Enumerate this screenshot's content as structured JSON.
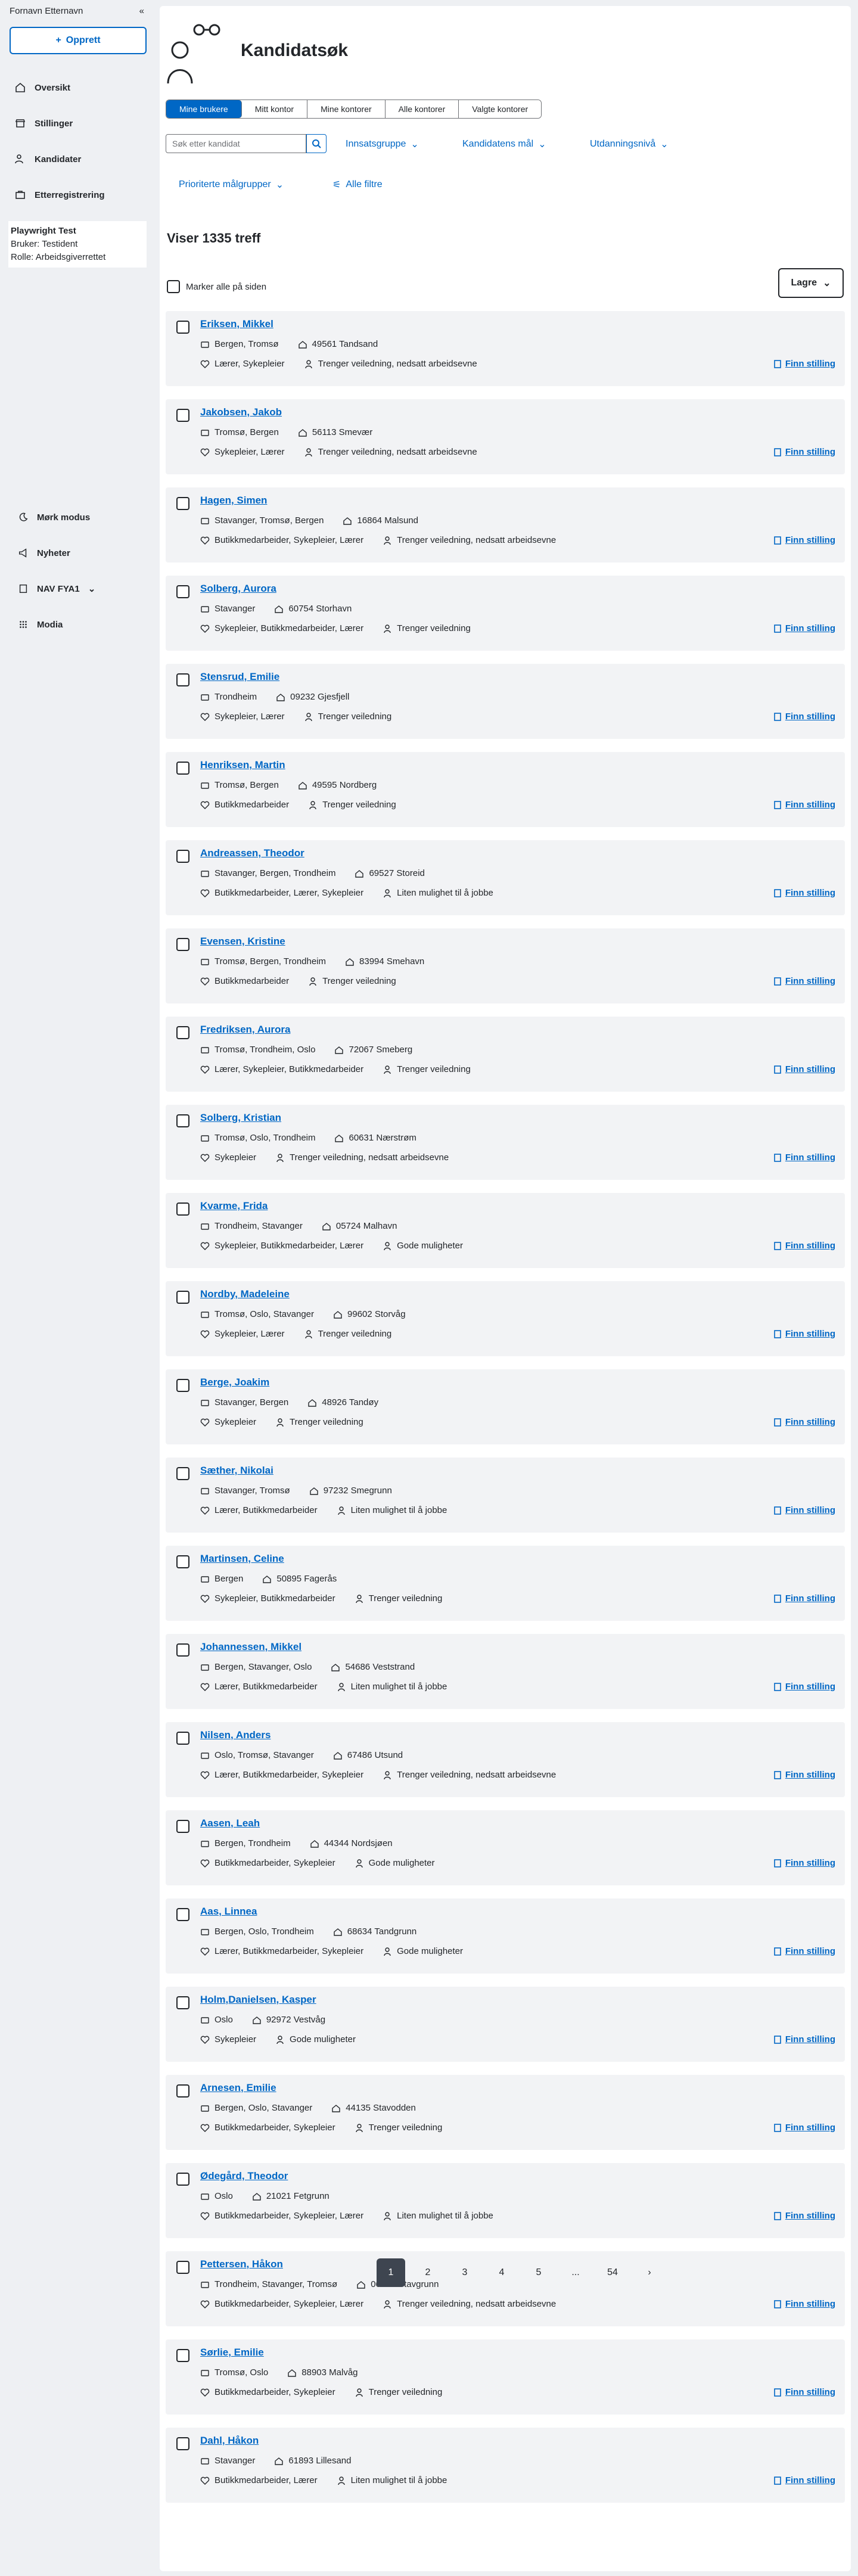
{
  "sidebar": {
    "user_name": "Fornavn Etternavn",
    "new_button": "Opprett",
    "nav": [
      {
        "label": "Oversikt",
        "icon": "house-icon"
      },
      {
        "label": "Stillinger",
        "icon": "shop-icon"
      },
      {
        "label": "Kandidater",
        "icon": "people-icon"
      },
      {
        "label": "Etterregistrering",
        "icon": "briefcase-icon"
      }
    ],
    "test_user": {
      "title": "Playwright Test",
      "bruker": "Bruker: Testident",
      "rolle": "Rolle: Arbeidsgiverrettet"
    },
    "bottom": [
      {
        "label": "Mørk modus",
        "icon": "moon-icon"
      },
      {
        "label": "Nyheter",
        "icon": "megaphone-icon"
      },
      {
        "label": "NAV FYA1",
        "icon": "building-icon"
      },
      {
        "label": "Modia",
        "icon": "grid-icon"
      }
    ]
  },
  "header": {
    "title": "Kandidatsøk"
  },
  "tabs": [
    "Mine brukere",
    "Mitt kontor",
    "Mine kontorer",
    "Alle kontorer",
    "Valgte kontorer"
  ],
  "search": {
    "placeholder": "Søk etter kandidat"
  },
  "filters": {
    "insatsgruppe": "Innsatsgruppe",
    "kandidatens_mal": "Kandidatens mål",
    "utdanningsniva": "Utdanningsnivå",
    "prioriterte": "Prioriterte målgrupper",
    "alle_filtre": "Alle filtre"
  },
  "results": {
    "count_text": "Viser 1335 treff",
    "mark_all": "Marker alle på siden",
    "save_button": "Lagre",
    "finn_stilling": "Finn stilling"
  },
  "candidates": [
    {
      "name": "Eriksen, Mikkel",
      "places": "Bergen, Tromsø",
      "address": "49561 Tandsand",
      "jobs": "Lærer, Sykepleier",
      "need": "Trenger veiledning, nedsatt arbeidsevne"
    },
    {
      "name": "Jakobsen, Jakob",
      "places": "Tromsø, Bergen",
      "address": "56113 Smevær",
      "jobs": "Sykepleier, Lærer",
      "need": "Trenger veiledning, nedsatt arbeidsevne"
    },
    {
      "name": "Hagen, Simen",
      "places": "Stavanger, Tromsø, Bergen",
      "address": "16864 Malsund",
      "jobs": "Butikkmedarbeider, Sykepleier, Lærer",
      "need": "Trenger veiledning, nedsatt arbeidsevne"
    },
    {
      "name": "Solberg, Aurora",
      "places": "Stavanger",
      "address": "60754 Storhavn",
      "jobs": "Sykepleier, Butikkmedarbeider, Lærer",
      "need": "Trenger veiledning"
    },
    {
      "name": "Stensrud, Emilie",
      "places": "Trondheim",
      "address": "09232 Gjesfjell",
      "jobs": "Sykepleier, Lærer",
      "need": "Trenger veiledning"
    },
    {
      "name": "Henriksen, Martin",
      "places": "Tromsø, Bergen",
      "address": "49595 Nordberg",
      "jobs": "Butikkmedarbeider",
      "need": "Trenger veiledning"
    },
    {
      "name": "Andreassen, Theodor",
      "places": "Stavanger, Bergen, Trondheim",
      "address": "69527 Storeid",
      "jobs": "Butikkmedarbeider, Lærer, Sykepleier",
      "need": "Liten mulighet til å jobbe"
    },
    {
      "name": "Evensen, Kristine",
      "places": "Tromsø, Bergen, Trondheim",
      "address": "83994 Smehavn",
      "jobs": "Butikkmedarbeider",
      "need": "Trenger veiledning"
    },
    {
      "name": "Fredriksen, Aurora",
      "places": "Tromsø, Trondheim, Oslo",
      "address": "72067 Smeberg",
      "jobs": "Lærer, Sykepleier, Butikkmedarbeider",
      "need": "Trenger veiledning"
    },
    {
      "name": "Solberg, Kristian",
      "places": "Tromsø, Oslo, Trondheim",
      "address": "60631 Nærstrøm",
      "jobs": "Sykepleier",
      "need": "Trenger veiledning, nedsatt arbeidsevne"
    },
    {
      "name": "Kvarme, Frida",
      "places": "Trondheim, Stavanger",
      "address": "05724 Malhavn",
      "jobs": "Sykepleier, Butikkmedarbeider, Lærer",
      "need": "Gode muligheter"
    },
    {
      "name": "Nordby, Madeleine",
      "places": "Tromsø, Oslo, Stavanger",
      "address": "99602 Storvåg",
      "jobs": "Sykepleier, Lærer",
      "need": "Trenger veiledning"
    },
    {
      "name": "Berge, Joakim",
      "places": "Stavanger, Bergen",
      "address": "48926 Tandøy",
      "jobs": "Sykepleier",
      "need": "Trenger veiledning"
    },
    {
      "name": "Sæther, Nikolai",
      "places": "Stavanger, Tromsø",
      "address": "97232 Smegrunn",
      "jobs": "Lærer, Butikkmedarbeider",
      "need": "Liten mulighet til å jobbe"
    },
    {
      "name": "Martinsen, Celine",
      "places": "Bergen",
      "address": "50895 Fagerås",
      "jobs": "Sykepleier, Butikkmedarbeider",
      "need": "Trenger veiledning"
    },
    {
      "name": "Johannessen, Mikkel",
      "places": "Bergen, Stavanger, Oslo",
      "address": "54686 Veststrand",
      "jobs": "Lærer, Butikkmedarbeider",
      "need": "Liten mulighet til å jobbe"
    },
    {
      "name": "Nilsen, Anders",
      "places": "Oslo, Tromsø, Stavanger",
      "address": "67486 Utsund",
      "jobs": "Lærer, Butikkmedarbeider, Sykepleier",
      "need": "Trenger veiledning, nedsatt arbeidsevne"
    },
    {
      "name": "Aasen, Leah",
      "places": "Bergen, Trondheim",
      "address": "44344 Nordsjøen",
      "jobs": "Butikkmedarbeider, Sykepleier",
      "need": "Gode muligheter"
    },
    {
      "name": "Aas, Linnea",
      "places": "Bergen, Oslo, Trondheim",
      "address": "68634 Tandgrunn",
      "jobs": "Lærer, Butikkmedarbeider, Sykepleier",
      "need": "Gode muligheter"
    },
    {
      "name": "Holm,Danielsen, Kasper",
      "places": "Oslo",
      "address": "92972 Vestvåg",
      "jobs": "Sykepleier",
      "need": "Gode muligheter"
    },
    {
      "name": "Arnesen, Emilie",
      "places": "Bergen, Oslo, Stavanger",
      "address": "44135 Stavodden",
      "jobs": "Butikkmedarbeider, Sykepleier",
      "need": "Trenger veiledning"
    },
    {
      "name": "Ødegård, Theodor",
      "places": "Oslo",
      "address": "21021 Fetgrunn",
      "jobs": "Butikkmedarbeider, Sykepleier, Lærer",
      "need": "Liten mulighet til å jobbe"
    },
    {
      "name": "Pettersen, Håkon",
      "places": "Trondheim, Stavanger, Tromsø",
      "address": "06228 Stavgrunn",
      "jobs": "Butikkmedarbeider, Sykepleier, Lærer",
      "need": "Trenger veiledning, nedsatt arbeidsevne"
    },
    {
      "name": "Sørlie, Emilie",
      "places": "Tromsø, Oslo",
      "address": "88903 Malvåg",
      "jobs": "Butikkmedarbeider, Sykepleier",
      "need": "Trenger veiledning"
    },
    {
      "name": "Dahl, Håkon",
      "places": "Stavanger",
      "address": "61893 Lillesand",
      "jobs": "Butikkmedarbeider, Lærer",
      "need": "Liten mulighet til å jobbe"
    }
  ],
  "pagination": {
    "pages": [
      "1",
      "2",
      "3",
      "4",
      "5",
      "...",
      "54"
    ],
    "active": "1"
  }
}
